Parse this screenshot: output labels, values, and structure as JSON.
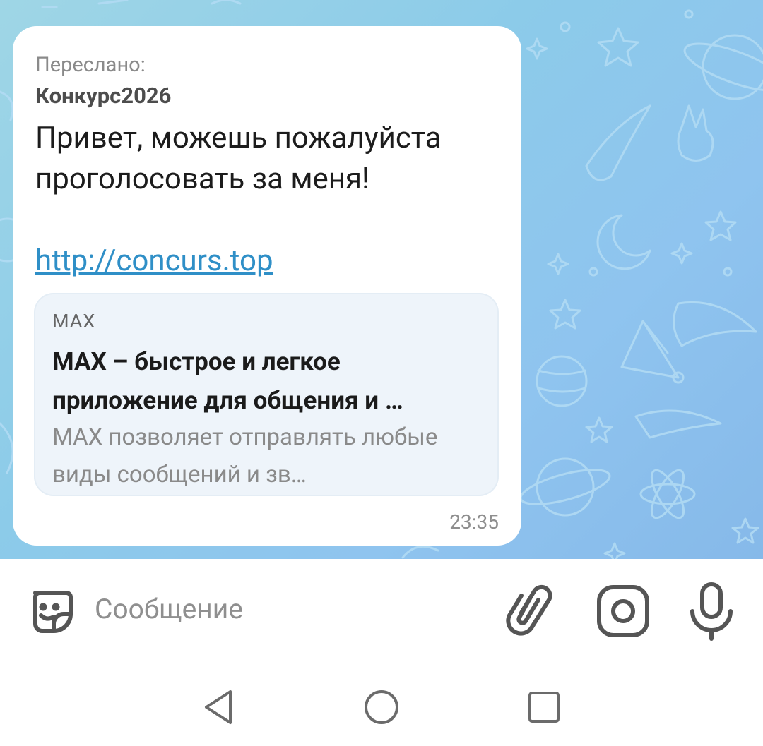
{
  "message": {
    "forwarded_label": "Переслано:",
    "forwarded_from": "Конкурс2026",
    "text": "Привет, можешь пожалуйста проголосовать за меня!",
    "link": "http://concurs.top",
    "time": "23:35"
  },
  "link_preview": {
    "site": "MAX",
    "title": "MAX – быстрое и легкое приложение для общения и …",
    "description": "MAX позволяет отправлять любые виды сообщений и зв…"
  },
  "composer": {
    "placeholder": "Сообщение",
    "icons": [
      "sticker-icon",
      "paperclip-icon",
      "camera-icon",
      "microphone-icon"
    ]
  },
  "navbar": {
    "icons": [
      "back-triangle-icon",
      "home-circle-icon",
      "recents-square-icon"
    ]
  },
  "colors": {
    "chat_background": "#8ccbe9",
    "link": "#2f8fc7",
    "preview_background": "#eef4fa",
    "icon_gray": "#555555"
  }
}
